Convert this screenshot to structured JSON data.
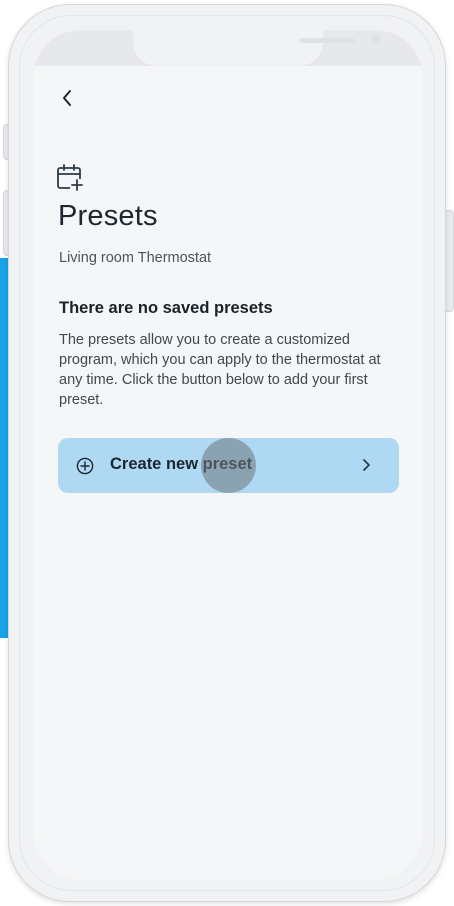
{
  "header": {
    "back_label": "Back",
    "title": "Presets",
    "subtitle": "Living room Thermostat",
    "title_icon": "calendar-plus-icon"
  },
  "empty_state": {
    "heading": "There are no saved presets",
    "description": "The presets allow you to create a customized program, which you can apply to the thermostat at any time. Click the button below to add your first preset."
  },
  "actions": {
    "create_label_part1": "Create new",
    "create_label_part2": " preset",
    "create_icon": "plus-circle-icon",
    "chevron_icon": "chevron-right-icon"
  },
  "colors": {
    "accent": "#1aa3e6",
    "button_bg": "#afd9f3",
    "text_primary": "#1d2730",
    "text_secondary": "#4b545c"
  }
}
